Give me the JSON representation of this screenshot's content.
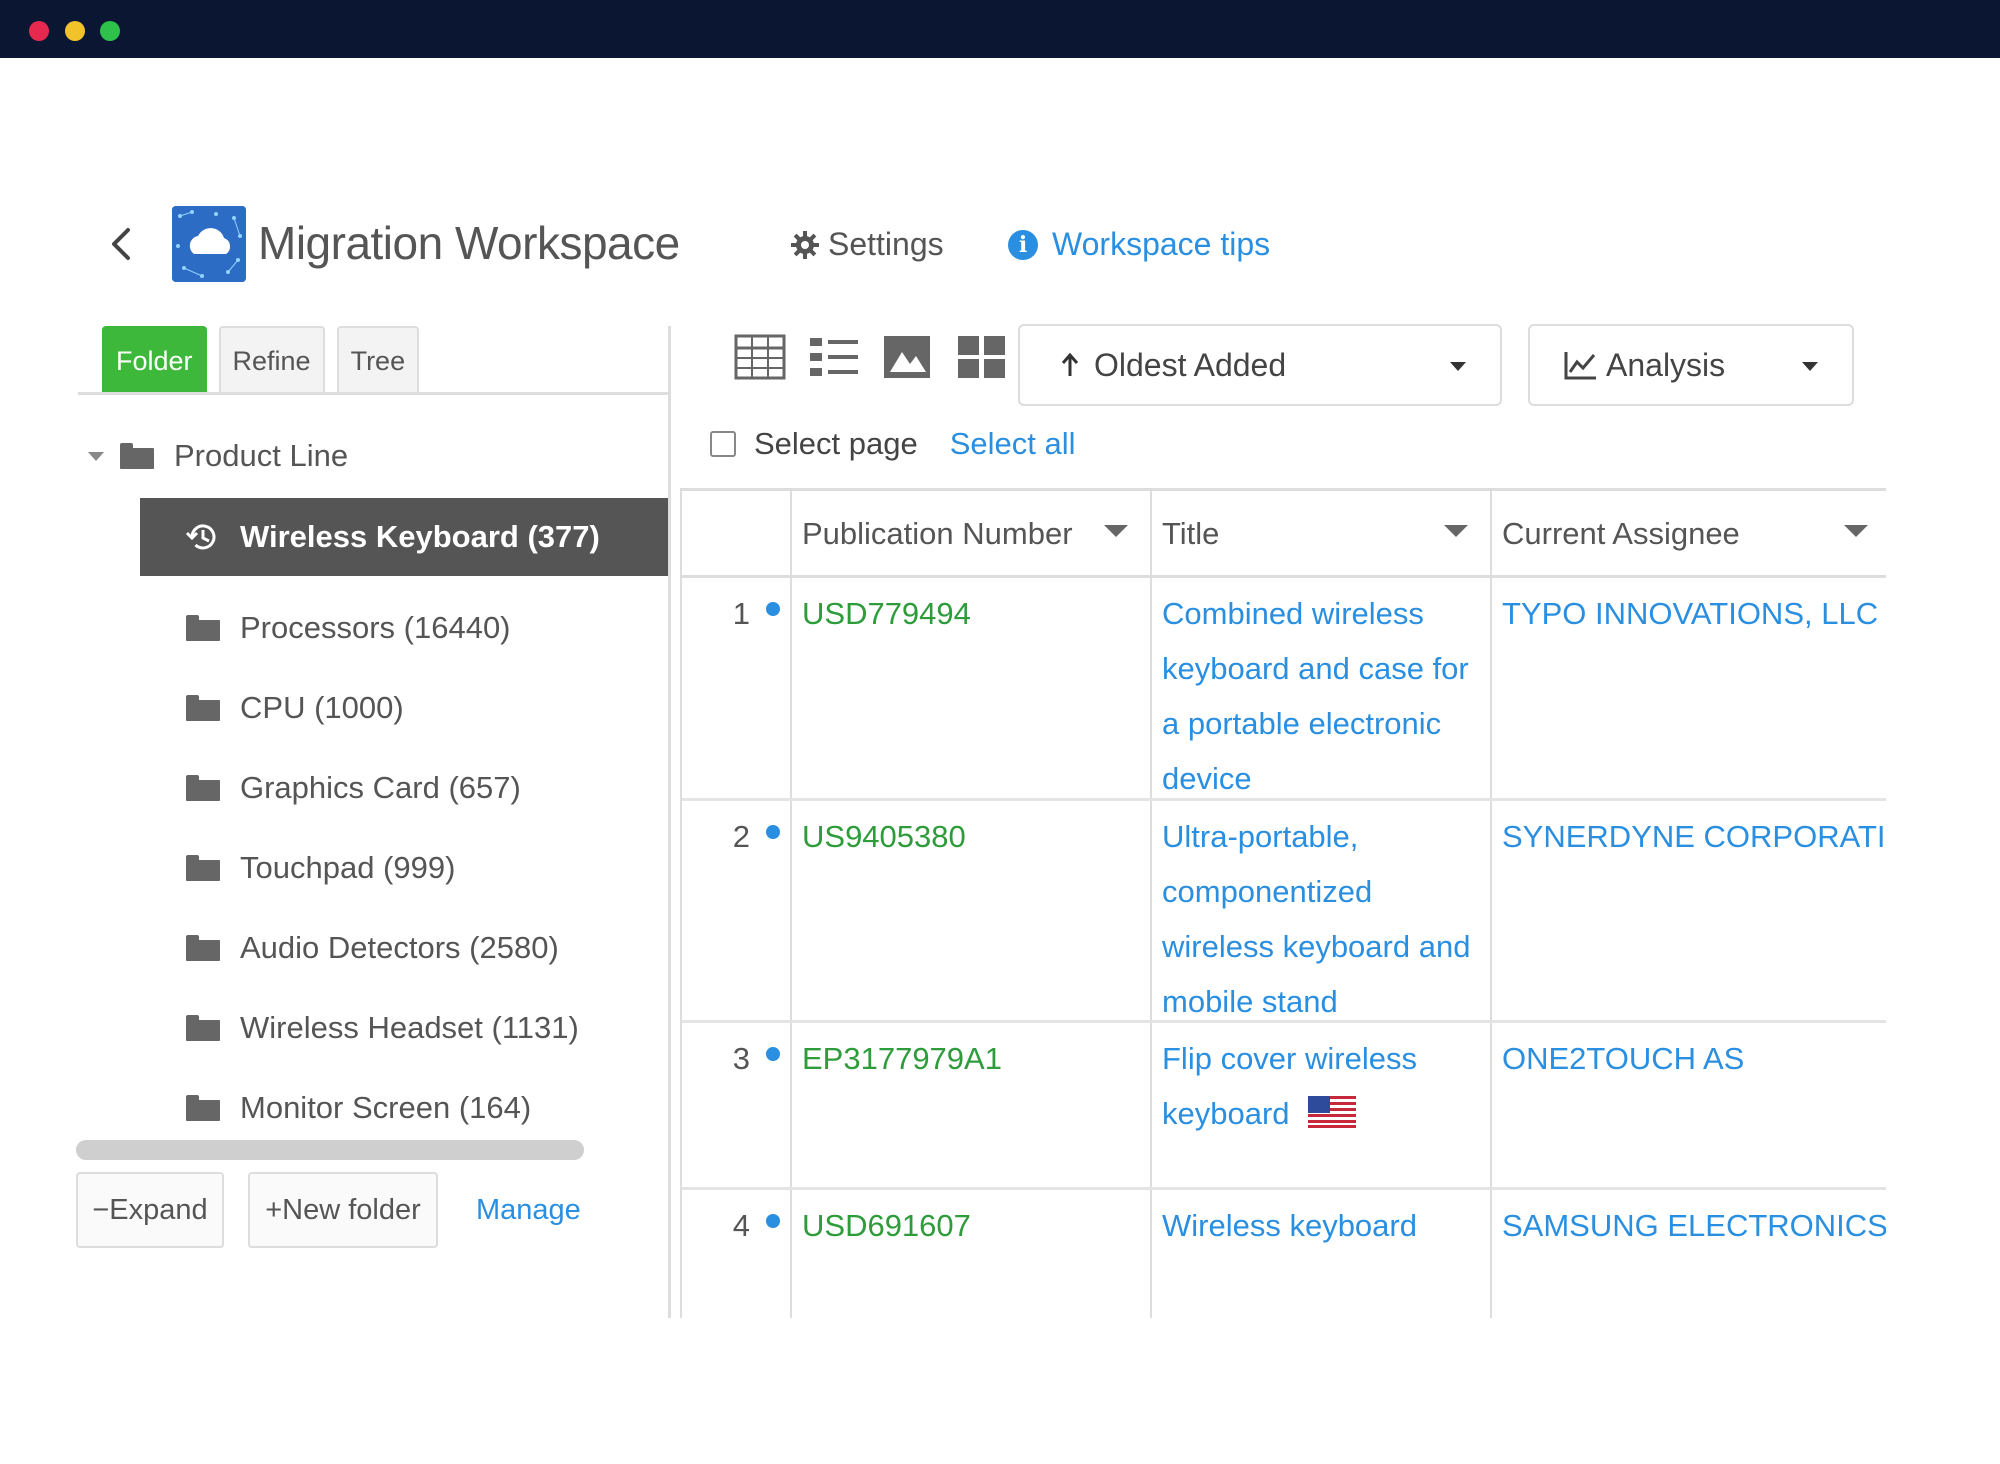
{
  "header": {
    "title": "Migration Workspace",
    "settings_label": "Settings",
    "tips_label": "Workspace tips"
  },
  "left_panel": {
    "tabs": [
      {
        "label": "Folder",
        "active": true
      },
      {
        "label": "Refine",
        "active": false
      },
      {
        "label": "Tree",
        "active": false
      }
    ],
    "root": "Product Line",
    "selected": "Wireless Keyboard (377)",
    "items": [
      "Processors (16440)",
      "CPU (1000)",
      "Graphics Card (657)",
      "Touchpad (999)",
      "Audio Detectors (2580)",
      "Wireless Headset (1131)",
      "Monitor Screen (164)"
    ],
    "expand_label": "Expand",
    "new_folder_label": "New folder",
    "manage_label": "Manage"
  },
  "toolbar": {
    "sort_label": "Oldest Added",
    "analysis_label": "Analysis",
    "select_page_label": "Select page",
    "select_all_label": "Select all"
  },
  "table": {
    "columns": [
      "Publication Number",
      "Title",
      "Current Assignee"
    ],
    "rows": [
      {
        "num": "1",
        "pub": "USD779494",
        "title": "Combined wireless keyboard and case for a portable electronic device",
        "assignee": "TYPO INNOVATIONS, LLC"
      },
      {
        "num": "2",
        "pub": "US9405380",
        "title": "Ultra-portable, componentized wireless keyboard and mobile stand",
        "assignee": "SYNERDYNE CORPORATI"
      },
      {
        "num": "3",
        "pub": "EP3177979A1",
        "title": "Flip cover wireless keyboard",
        "assignee": "ONE2TOUCH AS"
      },
      {
        "num": "4",
        "pub": "USD691607",
        "title": "Wireless keyboard",
        "assignee": "SAMSUNG ELECTRONICS"
      }
    ]
  },
  "colors": {
    "titlebar": "#0b1633",
    "accent_green": "#3db83a",
    "link_blue": "#2a8fe0",
    "pub_green": "#2e9c3a",
    "selected_bg": "#555555"
  },
  "icons": {
    "back": "chevron-left-icon",
    "settings": "gear-icon",
    "tips": "info-icon",
    "folder": "folder-open-icon",
    "history": "history-icon",
    "views": [
      "table-view-icon",
      "list-view-icon",
      "image-view-icon",
      "grid-view-icon"
    ],
    "sort": "arrow-up-icon",
    "analysis": "line-chart-icon",
    "flag": "us-flag-icon"
  }
}
